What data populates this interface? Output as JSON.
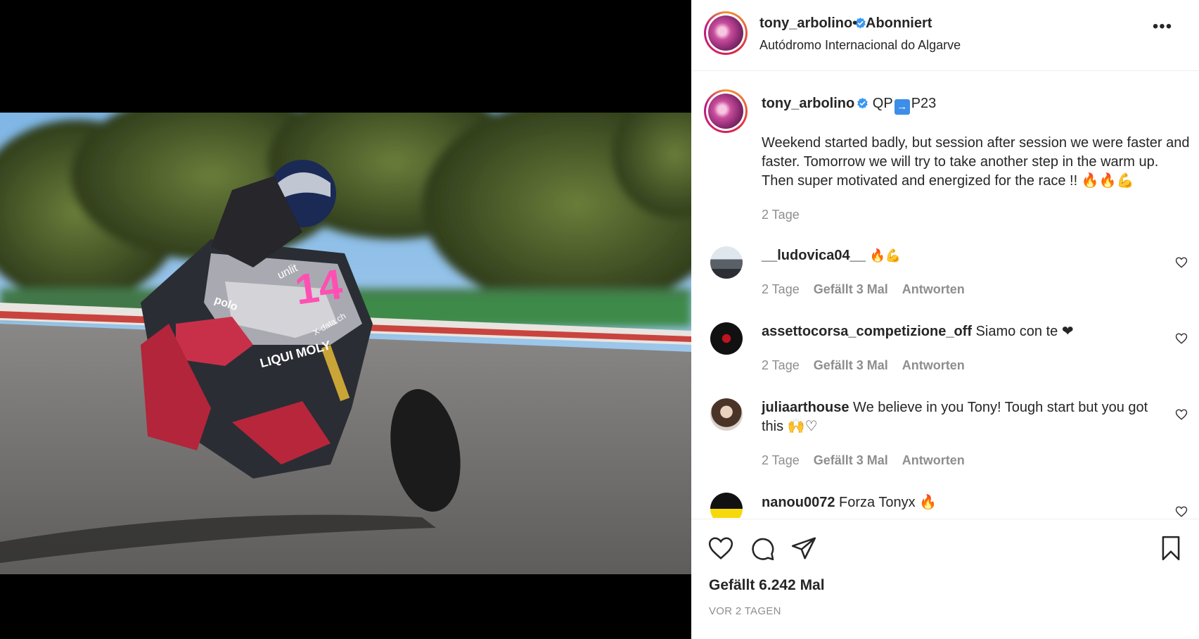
{
  "header": {
    "username": "tony_arbolino",
    "separator": "•",
    "follow_state": "Abonniert",
    "location": "Autódromo Internacional do Algarve",
    "more_label": "•••"
  },
  "caption": {
    "username": "tony_arbolino",
    "headline_a": "QP",
    "headline_arrow": "→",
    "headline_b": "P23",
    "text": "Weekend started badly, but session after session we were faster and faster. Tomorrow we will try to take another step in the warm up. Then super motivated and energized for the race !! 🔥🔥💪",
    "time": "2 Tage"
  },
  "comments": [
    {
      "username": "__ludovica04__",
      "text": "🔥💪",
      "time": "2 Tage",
      "likes": "Gefällt 3 Mal",
      "reply": "Antworten"
    },
    {
      "username": "assettocorsa_competizione_off",
      "text": "Siamo con te ❤",
      "time": "2 Tage",
      "likes": "Gefällt 3 Mal",
      "reply": "Antworten"
    },
    {
      "username": "juliaarthouse",
      "text": "We believe in you Tony! Tough start but you got this 🙌♡",
      "time": "2 Tage",
      "likes": "Gefällt 3 Mal",
      "reply": "Antworten"
    },
    {
      "username": "nanou0072",
      "text": "Forza Tonyx 🔥",
      "time": "",
      "likes": "",
      "reply": ""
    }
  ],
  "footer": {
    "likes": "Gefällt 6.242 Mal",
    "time": "VOR 2 TAGEN"
  },
  "photo": {
    "rider_number": "14",
    "sponsor_a": "LIQUI MOLY",
    "sponsor_b": "polo",
    "sponsor_c": "unlit",
    "sponsor_d": "X-data.ch"
  },
  "colors": {
    "verified": "#3897f0",
    "muted": "#8e8e8e",
    "text": "#262626"
  }
}
